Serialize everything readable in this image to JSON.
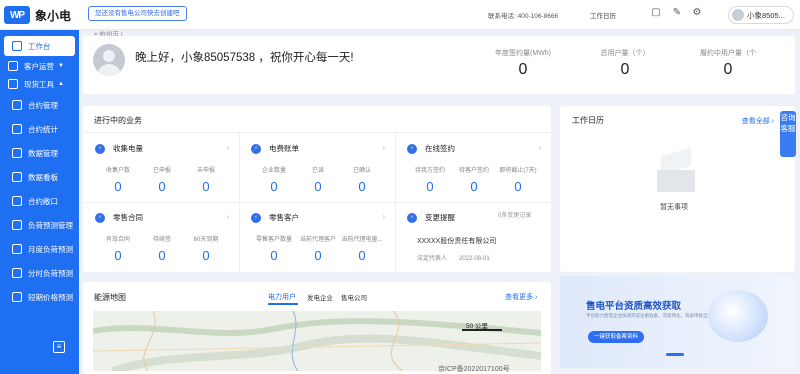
{
  "brand": {
    "mark": "WP",
    "name": "象小电"
  },
  "topbar": {
    "register_label": "您还没有售电公司快去创建吧",
    "phone": "联系电话: 400-106-8666",
    "calendar_label": "工作日历",
    "user_name": "小象85057538",
    "user_name_display": "小象8505..."
  },
  "sidebar": {
    "items": [
      {
        "label": "工作台",
        "active": true,
        "icon": "monitor-icon"
      },
      {
        "label": "客户运营",
        "icon": "users-icon"
      },
      {
        "label": "现货工具",
        "icon": "tool-icon"
      },
      {
        "label": "合约管理",
        "icon": "contract-icon"
      },
      {
        "label": "合约统计",
        "icon": "stats-icon"
      },
      {
        "label": "数据管理",
        "icon": "database-icon"
      },
      {
        "label": "数据看板",
        "icon": "dashboard-icon"
      },
      {
        "label": "合约敞口",
        "icon": "exposure-icon"
      },
      {
        "label": "负荷预测管理",
        "icon": "forecast-icon"
      },
      {
        "label": "月度负荷预测",
        "icon": "forecast-icon"
      },
      {
        "label": "分时负荷预测",
        "icon": "forecast-icon"
      },
      {
        "label": "短期价格预测",
        "icon": "price-icon"
      }
    ]
  },
  "breadcrumb": "杭州市 /",
  "welcome": {
    "greeting": "晚上好，小象85057538 ，祝你开心每一天!",
    "stats": [
      {
        "label": "年度签约量(MWh)",
        "value": "0"
      },
      {
        "label": "总用户量（个）",
        "value": "0"
      },
      {
        "label": "履约中用户量（个",
        "value": "0"
      }
    ]
  },
  "business": {
    "title": "进行中的业务",
    "cards": [
      {
        "title": "收集电量",
        "cols": [
          {
            "k": "收集户数",
            "v": "0"
          },
          {
            "k": "已申报",
            "v": "0"
          },
          {
            "k": "未申报",
            "v": "0"
          }
        ]
      },
      {
        "title": "电费账单",
        "cols": [
          {
            "k": "企业数量",
            "v": "0"
          },
          {
            "k": "已读",
            "v": "0"
          },
          {
            "k": "已确认",
            "v": "0"
          }
        ]
      },
      {
        "title": "在线签约",
        "cols": [
          {
            "k": "待我方签约",
            "v": "0"
          },
          {
            "k": "待客户签约",
            "v": "0"
          },
          {
            "k": "即将截止(7天)",
            "v": "0"
          }
        ]
      },
      {
        "title": "零售合同",
        "cols": [
          {
            "k": "有效合同",
            "v": "0"
          },
          {
            "k": "待续签",
            "v": "0"
          },
          {
            "k": "60天到期",
            "v": "0"
          }
        ]
      },
      {
        "title": "零售客户",
        "cols": [
          {
            "k": "零售客户数量",
            "v": "0"
          },
          {
            "k": "当前代理客户",
            "v": "0"
          },
          {
            "k": "当前代理电量...",
            "v": "0"
          }
        ]
      },
      {
        "title": "变更提醒"
      }
    ],
    "change_count": "0条变更记录",
    "company_name": "XXXXX股份责任有限公司",
    "legal_label": "法定代表人",
    "legal_date": "2022-08-01"
  },
  "calendar": {
    "title": "工作日历",
    "view_all": "查看全部",
    "empty": "暂无事项",
    "consult": "咨询客服"
  },
  "energy_map": {
    "title": "能源地图",
    "tabs": [
      "电力用户",
      "发电企业",
      "售电公司"
    ],
    "more": "查看更多",
    "scale": "50 公里"
  },
  "promo": {
    "title": "售电平台资质高效获取",
    "subtitle": "平台助力售电企业快速完成注册准备，流程简化，资质审核全程跟进",
    "button": "一键获取备案资料"
  },
  "footer": {
    "icp": "京ICP备2022017100号"
  },
  "colors": {
    "primary": "#1f6ff2",
    "background": "#eef2f8"
  }
}
